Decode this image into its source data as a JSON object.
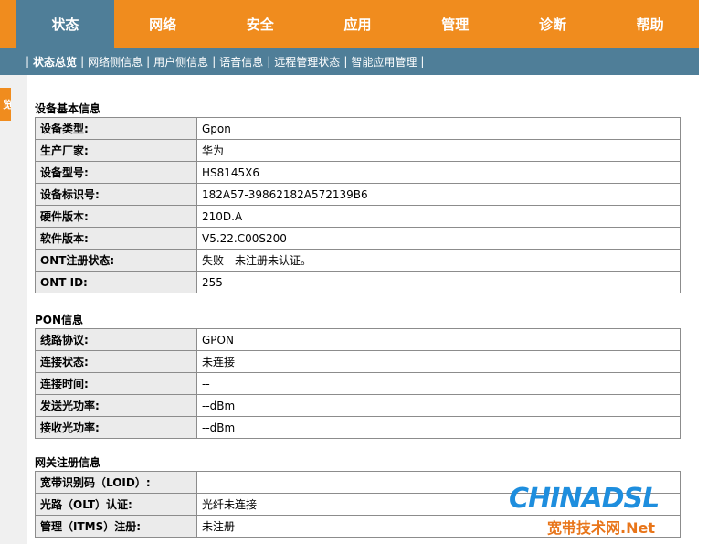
{
  "topnav": {
    "tabs": [
      {
        "label": "状态",
        "active": true
      },
      {
        "label": "网络",
        "active": false
      },
      {
        "label": "安全",
        "active": false
      },
      {
        "label": "应用",
        "active": false
      },
      {
        "label": "管理",
        "active": false
      },
      {
        "label": "诊断",
        "active": false
      },
      {
        "label": "帮助",
        "active": false
      }
    ]
  },
  "subnav": {
    "items": [
      {
        "label": "状态总览",
        "active": true
      },
      {
        "label": "网络侧信息",
        "active": false
      },
      {
        "label": "用户侧信息",
        "active": false
      },
      {
        "label": "语音信息",
        "active": false
      },
      {
        "label": "远程管理状态",
        "active": false
      },
      {
        "label": "智能应用管理",
        "active": false
      }
    ],
    "separator": "|"
  },
  "sidebar": {
    "tab_label": "览"
  },
  "sections": [
    {
      "title": "设备基本信息",
      "rows": [
        {
          "key": "设备类型:",
          "value": "Gpon"
        },
        {
          "key": "生产厂家:",
          "value": "华为"
        },
        {
          "key": "设备型号:",
          "value": "HS8145X6"
        },
        {
          "key": "设备标识号:",
          "value": "182A57-39862182A572139B6"
        },
        {
          "key": "硬件版本:",
          "value": "210D.A"
        },
        {
          "key": "软件版本:",
          "value": "V5.22.C00S200"
        },
        {
          "key": "ONT注册状态:",
          "value": "失败 - 未注册未认证。"
        },
        {
          "key": "ONT ID:",
          "value": "255"
        }
      ]
    },
    {
      "title": "PON信息",
      "rows": [
        {
          "key": "线路协议:",
          "value": "GPON"
        },
        {
          "key": "连接状态:",
          "value": "未连接"
        },
        {
          "key": "连接时间:",
          "value": "--"
        },
        {
          "key": "发送光功率:",
          "value": "--dBm"
        },
        {
          "key": "接收光功率:",
          "value": "--dBm"
        }
      ]
    },
    {
      "title": "网关注册信息",
      "rows": [
        {
          "key": "宽带识别码（LOID）:",
          "value": ""
        },
        {
          "key": "光路（OLT）认证:",
          "value": "光纤未连接"
        },
        {
          "key": "管理（ITMS）注册:",
          "value": "未注册"
        }
      ]
    }
  ],
  "watermark": {
    "line1": "CHINADSL",
    "line2": "宽带技术网.Net"
  },
  "colors": {
    "nav_orange": "#f08c1e",
    "nav_blue": "#4f7e98",
    "key_cell_bg": "#ebebeb",
    "border": "#8c8c8c"
  }
}
